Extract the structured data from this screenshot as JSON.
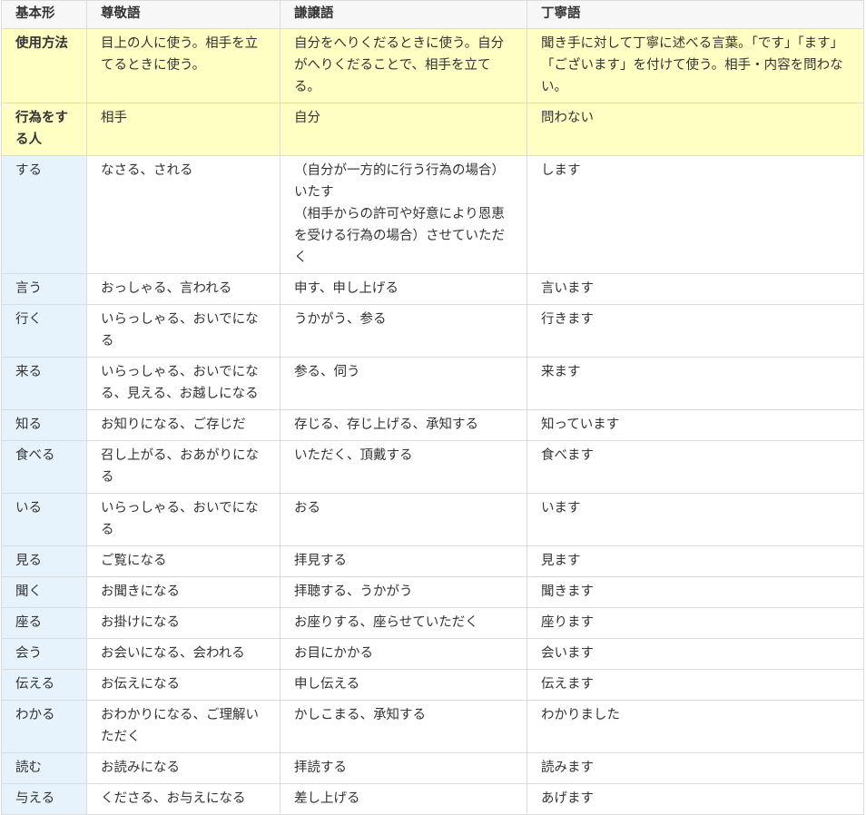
{
  "header": [
    "基本形",
    "尊敬語",
    "謙譲語",
    "丁寧語"
  ],
  "usage_rows": [
    {
      "label": "使用方法",
      "cells": [
        "目上の人に使う。相手を立てるときに使う。",
        "自分をへりくだるときに使う。自分がへりくだることで、相手を立てる。",
        "聞き手に対して丁寧に述べる言葉。「です」「ます」「ございます」を付けて使う。相手・内容を問わない。"
      ]
    },
    {
      "label": "行為をする人",
      "cells": [
        "相手",
        "自分",
        "問わない"
      ]
    }
  ],
  "rows": [
    {
      "base": "する",
      "sonkei": "なさる、される",
      "kenjo": "（自分が一方的に行う行為の場合）いたす\n（相手からの許可や好意により恩恵を受ける行為の場合）させていただく",
      "teinei": "します"
    },
    {
      "base": "言う",
      "sonkei": "おっしゃる、言われる",
      "kenjo": "申す、申し上げる",
      "teinei": "言います"
    },
    {
      "base": "行く",
      "sonkei": "いらっしゃる、おいでになる",
      "kenjo": "うかがう、参る",
      "teinei": "行きます"
    },
    {
      "base": "来る",
      "sonkei": "いらっしゃる、おいでになる、見える、お越しになる",
      "kenjo": "参る、伺う",
      "teinei": "来ます"
    },
    {
      "base": "知る",
      "sonkei": "お知りになる、ご存じだ",
      "kenjo": "存じる、存じ上げる、承知する",
      "teinei": "知っています"
    },
    {
      "base": "食べる",
      "sonkei": "召し上がる、おあがりになる",
      "kenjo": "いただく、頂戴する",
      "teinei": "食べます"
    },
    {
      "base": "いる",
      "sonkei": "いらっしゃる、おいでになる",
      "kenjo": "おる",
      "teinei": "います"
    },
    {
      "base": "見る",
      "sonkei": "ご覧になる",
      "kenjo": "拝見する",
      "teinei": "見ます"
    },
    {
      "base": "聞く",
      "sonkei": "お聞きになる",
      "kenjo": "拝聴する、うかがう",
      "teinei": "聞きます"
    },
    {
      "base": "座る",
      "sonkei": "お掛けになる",
      "kenjo": "お座りする、座らせていただく",
      "teinei": "座ります"
    },
    {
      "base": "会う",
      "sonkei": "お会いになる、会われる",
      "kenjo": "お目にかかる",
      "teinei": "会います"
    },
    {
      "base": "伝える",
      "sonkei": "お伝えになる",
      "kenjo": "申し伝える",
      "teinei": "伝えます"
    },
    {
      "base": "わかる",
      "sonkei": "おわかりになる、ご理解いただく",
      "kenjo": "かしこまる、承知する",
      "teinei": "わかりました"
    },
    {
      "base": "読む",
      "sonkei": "お読みになる",
      "kenjo": "拝読する",
      "teinei": "読みます"
    },
    {
      "base": "与える",
      "sonkei": "くださる、お与えになる",
      "kenjo": "差し上げる",
      "teinei": "あげます"
    }
  ]
}
